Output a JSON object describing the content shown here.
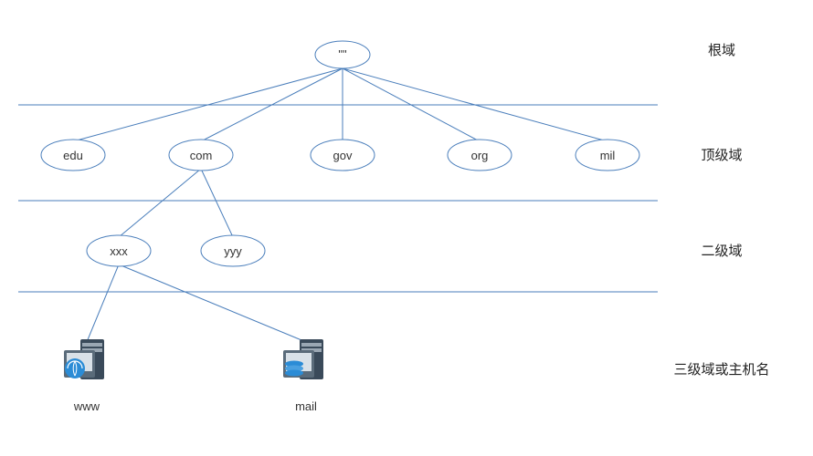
{
  "labels": {
    "level1": "根域",
    "level2": "顶级域",
    "level3": "二级域",
    "level4": "三级域或主机名"
  },
  "root": {
    "text": "\"\""
  },
  "tlds": [
    {
      "text": "edu"
    },
    {
      "text": "com"
    },
    {
      "text": "gov"
    },
    {
      "text": "org"
    },
    {
      "text": "mil"
    }
  ],
  "second": [
    {
      "text": "xxx"
    },
    {
      "text": "yyy"
    }
  ],
  "hosts": [
    {
      "text": "www"
    },
    {
      "text": "mail"
    }
  ]
}
